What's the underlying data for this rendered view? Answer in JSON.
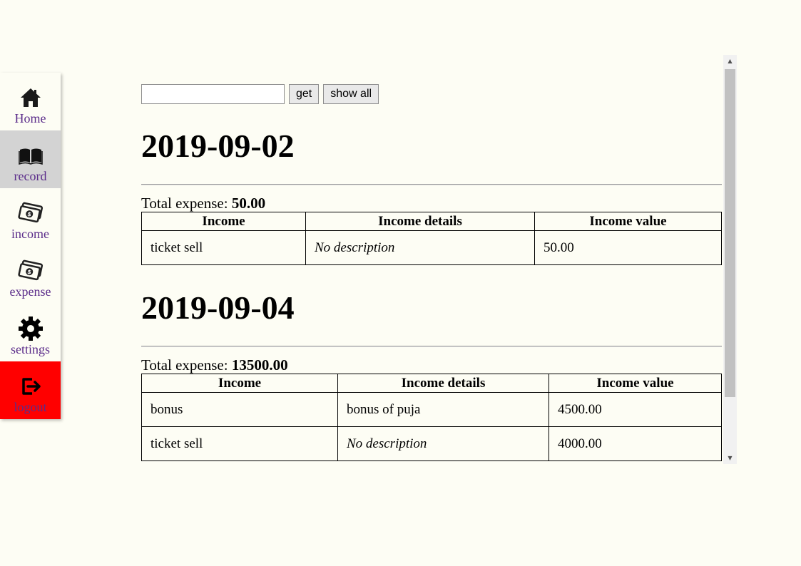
{
  "nav": {
    "items": [
      {
        "label": "Home",
        "icon": "home-icon"
      },
      {
        "label": "record",
        "icon": "book-icon"
      },
      {
        "label": "income",
        "icon": "money-icon"
      },
      {
        "label": "expense",
        "icon": "money-icon"
      },
      {
        "label": "settings",
        "icon": "gear-icon"
      },
      {
        "label": "logout",
        "icon": "logout-icon"
      }
    ],
    "active": "record",
    "logout_color": "#ff0000",
    "label_color": "#5b2c8a"
  },
  "search": {
    "value": "",
    "get_label": "get",
    "show_all_label": "show all"
  },
  "days": [
    {
      "date": "2019-09-02",
      "total_label": "Total expense:",
      "total_value": "50.00",
      "headers": [
        "Income",
        "Income details",
        "Income value"
      ],
      "rows": [
        {
          "income": "ticket sell",
          "details": "No description",
          "value": "50.00"
        }
      ]
    },
    {
      "date": "2019-09-04",
      "total_label": "Total expense:",
      "total_value": "13500.00",
      "headers": [
        "Income",
        "Income details",
        "Income value"
      ],
      "rows": [
        {
          "income": "bonus",
          "details": "bonus of puja",
          "value": "4500.00"
        },
        {
          "income": "ticket sell",
          "details": "No description",
          "value": "4000.00"
        }
      ]
    }
  ]
}
